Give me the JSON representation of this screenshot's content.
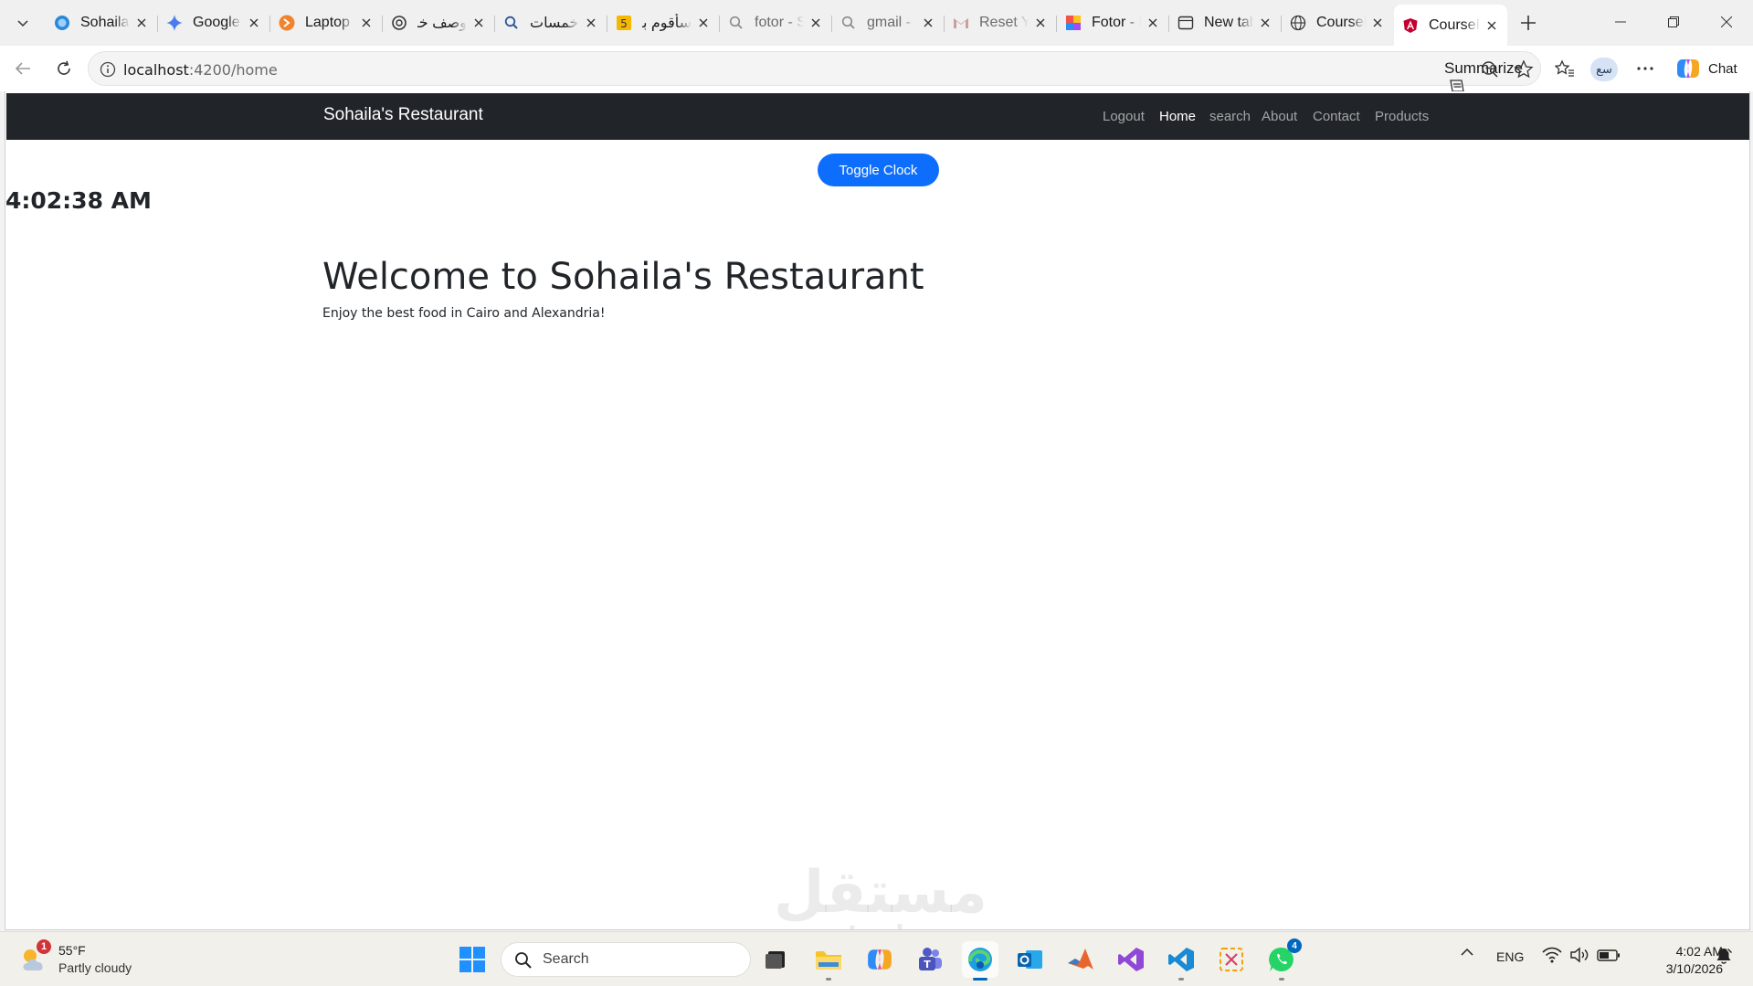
{
  "tabs": [
    {
      "title": "Sohaila's Restaurant",
      "icon": "blue-dot-icon"
    },
    {
      "title": "Google Gemini",
      "icon": "gemini-icon"
    },
    {
      "title": "Laptop Price",
      "icon": "orange-logo-icon"
    },
    {
      "title": "وصف خدمة",
      "icon": "openai-icon"
    },
    {
      "title": "خمسات",
      "icon": "search-icon"
    },
    {
      "title": "سأقوم بتصميم",
      "icon": "khamsat-icon"
    },
    {
      "title": "fotor - Search",
      "icon": "search-icon"
    },
    {
      "title": "gmail - Search",
      "icon": "search-icon"
    },
    {
      "title": "Reset Your Password",
      "icon": "gmail-icon"
    },
    {
      "title": "Fotor - Photo",
      "icon": "fotor-icon"
    },
    {
      "title": "New tab",
      "icon": "new-tab-icon"
    },
    {
      "title": "CourseProject",
      "icon": "globe-icon"
    },
    {
      "title": "CourseProject",
      "icon": "angular-icon"
    }
  ],
  "browser": {
    "url_host": "localhost",
    "url_path": ":4200/home",
    "summarize_label": "Summarize",
    "profile_label": "سع",
    "chat_label": "Chat"
  },
  "site": {
    "brand": "Sohaila's Restaurant",
    "nav": [
      "Logout",
      "Home",
      "search",
      "About",
      "Contact",
      "Products"
    ],
    "active_nav": "Home",
    "toggle_clock_label": "Toggle Clock",
    "clock_time": "4:02:38 AM",
    "hero_title": "Welcome to Sohaila's Restaurant",
    "hero_text": "Enjoy the best food in Cairo and Alexandria!",
    "watermark_ar": "مستقل",
    "watermark_en": "mostaql.com"
  },
  "taskbar": {
    "weather_temp": "55°F",
    "weather_condition": "Partly cloudy",
    "weather_badge": "1",
    "search_label": "Search",
    "language": "ENG",
    "time": "4:02 AM",
    "date": "3/10/2026",
    "whatsapp_badge": "4"
  }
}
